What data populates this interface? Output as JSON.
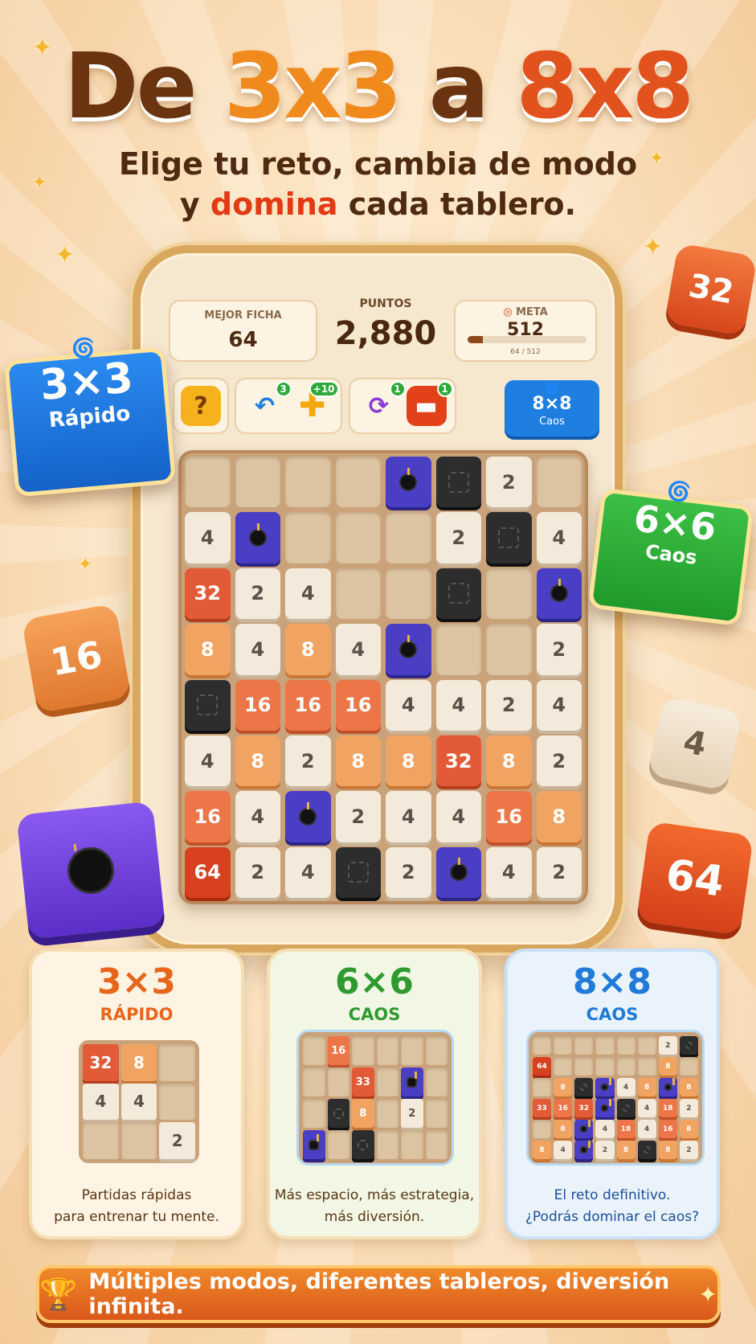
{
  "header": {
    "title_de": "De",
    "title_a": "3x3",
    "title_mid": "a",
    "title_b": "8x8",
    "subtitle_line1": "Elige tu reto, cambia de modo",
    "subtitle_line2_pre": "y",
    "subtitle_line2_hl": "domina",
    "subtitle_line2_post": "cada tablero."
  },
  "hud": {
    "best_tile_label": "MEJOR FICHA",
    "best_tile_value": "64",
    "points_label": "PUNTOS",
    "points_value": "2,880",
    "goal_label": "META",
    "goal_value": "512",
    "goal_progress_text": "64 / 512",
    "goal_progress": 0.125
  },
  "powerups": [
    {
      "name": "help",
      "icon": "question-icon",
      "badge": ""
    },
    {
      "name": "undo",
      "icon": "undo-icon",
      "badge": "3"
    },
    {
      "name": "plus",
      "icon": "plus-icon",
      "badge": "+10"
    },
    {
      "name": "shuffle",
      "icon": "shuffle-icon",
      "badge": "1"
    },
    {
      "name": "remove",
      "icon": "minus-icon",
      "badge": "1"
    }
  ],
  "mode_button": {
    "size": "8×8",
    "mode": "Caos"
  },
  "board": [
    [
      "",
      "",
      "",
      "",
      "B",
      "X",
      "2",
      ""
    ],
    [
      "4",
      "B",
      "",
      "",
      "",
      "2",
      "X",
      "4"
    ],
    [
      "32",
      "2",
      "4",
      "",
      "",
      "X",
      "",
      "B"
    ],
    [
      "8",
      "4",
      "8",
      "4",
      "B",
      "",
      "",
      "2"
    ],
    [
      "X",
      "16",
      "16",
      "16",
      "4",
      "4",
      "2",
      "4"
    ],
    [
      "4",
      "8",
      "2",
      "8",
      "8",
      "32",
      "8",
      "2"
    ],
    [
      "16",
      "4",
      "B",
      "2",
      "4",
      "4",
      "16",
      "8"
    ],
    [
      "64",
      "2",
      "4",
      "X",
      "2",
      "B",
      "4",
      "2"
    ]
  ],
  "floating": {
    "card_left": {
      "size": "3×3",
      "mode": "Rápido"
    },
    "card_right": {
      "size": "6×6",
      "mode": "Caos"
    },
    "tile_32": "32",
    "tile_16": "16",
    "tile_4": "4",
    "tile_64": "64"
  },
  "modes": [
    {
      "size": "3×3",
      "name": "RÁPIDO",
      "desc1": "Partidas rápidas",
      "desc2": "para entrenar tu mente.",
      "color": "#e8661c"
    },
    {
      "size": "6×6",
      "name": "CAOS",
      "desc1": "Más espacio, más estrategia,",
      "desc2": "más diversión.",
      "color": "#2f9a2f"
    },
    {
      "size": "8×8",
      "name": "CAOS",
      "desc1": "El reto definitivo.",
      "desc2": "¿Podrás dominar el caos?",
      "color": "#1f7ad8"
    }
  ],
  "mini3": [
    "32",
    "8",
    "",
    "4",
    "4",
    "",
    "",
    "",
    "2"
  ],
  "mini6": [
    [
      "",
      "16",
      "",
      "",
      "",
      ""
    ],
    [
      "",
      "",
      "33",
      "",
      "B",
      ""
    ],
    [
      "",
      "X",
      "8",
      "",
      "2",
      ""
    ],
    [
      "B",
      "",
      "X",
      "",
      "",
      ""
    ]
  ],
  "mini8": [
    [
      "",
      "",
      "",
      "",
      "",
      "",
      "2",
      "X"
    ],
    [
      "64",
      "",
      "",
      "",
      "",
      "",
      "8",
      ""
    ],
    [
      "",
      "8",
      "X",
      "B",
      "4",
      "8",
      "B",
      "8"
    ],
    [
      "33",
      "16",
      "32",
      "B",
      "X",
      "4",
      "18",
      "2"
    ],
    [
      "",
      "8",
      "B",
      "4",
      "18",
      "4",
      "16",
      "8"
    ],
    [
      "8",
      "4",
      "B",
      "2",
      "8",
      "X",
      "8",
      "2"
    ]
  ],
  "footer": "Múltiples modos, diferentes tableros, diversión infinita."
}
